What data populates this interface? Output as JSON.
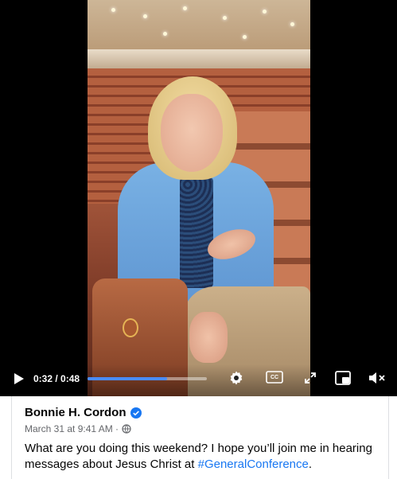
{
  "player": {
    "current_time": "0:32",
    "duration": "0:48",
    "time_display": "0:32 / 0:48",
    "progress_fraction": 0.667,
    "accent_color": "#4a8cf7",
    "icons": [
      "play-icon",
      "gear-icon",
      "closed-captions-icon",
      "expand-icon",
      "picture-in-picture-icon",
      "volume-muted-icon"
    ],
    "cc_label": "CC"
  },
  "post": {
    "author": "Bonnie H. Cordon",
    "verified": true,
    "verified_color": "#1877f2",
    "date": "March 31 at 9:41 AM ·",
    "caption_text": "What are you doing this weekend? I hope you’ll join me in hearing messages about Jesus Christ at ",
    "hashtag": "#GeneralConference",
    "caption_end": ".",
    "hashtag_color": "#1877f2"
  }
}
